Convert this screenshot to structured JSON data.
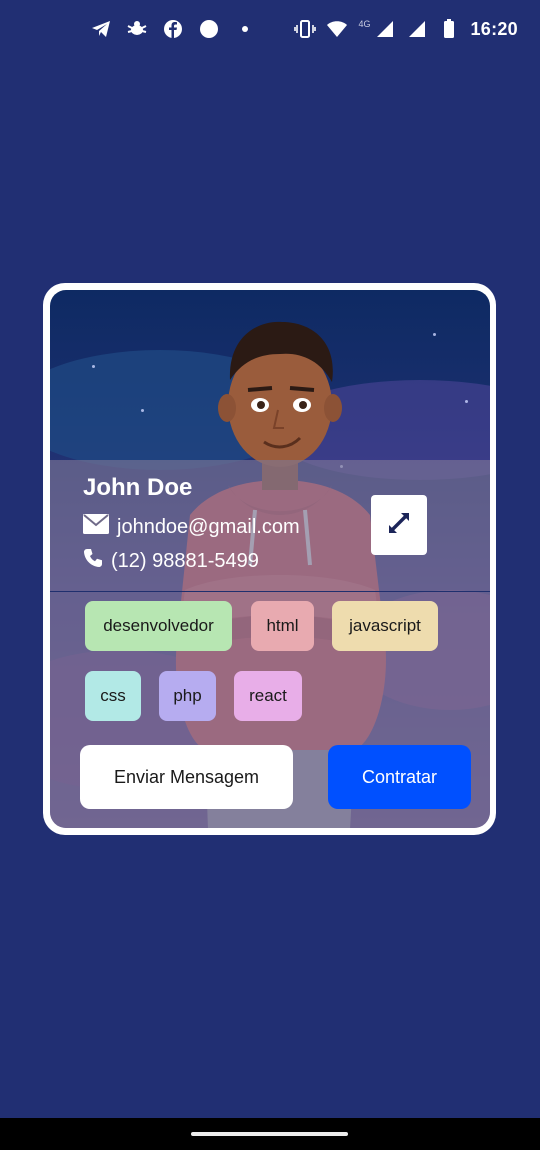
{
  "status_bar": {
    "time": "16:20",
    "network": "4G",
    "left_icons": [
      "telegram-icon",
      "bug-icon",
      "facebook-icon",
      "circle-icon",
      "dot-icon"
    ],
    "right_icons": [
      "vibrate-icon",
      "wifi-icon",
      "signal-icon",
      "signal-icon",
      "battery-icon"
    ]
  },
  "profile": {
    "name": "John Doe",
    "email": "johndoe@gmail.com",
    "phone": "(12) 98881-5499"
  },
  "tags": [
    {
      "label": "desenvolvedor",
      "color": "#b7e6b2"
    },
    {
      "label": "html",
      "color": "#e8aab0"
    },
    {
      "label": "javascript",
      "color": "#eedcae"
    },
    {
      "label": "css",
      "color": "#b2e9e6"
    },
    {
      "label": "php",
      "color": "#b6acf0"
    },
    {
      "label": "react",
      "color": "#e8aee8"
    }
  ],
  "actions": {
    "message_label": "Enviar Mensagem",
    "hire_label": "Contratar"
  },
  "colors": {
    "background": "#212f73",
    "accent": "#0050ff"
  }
}
